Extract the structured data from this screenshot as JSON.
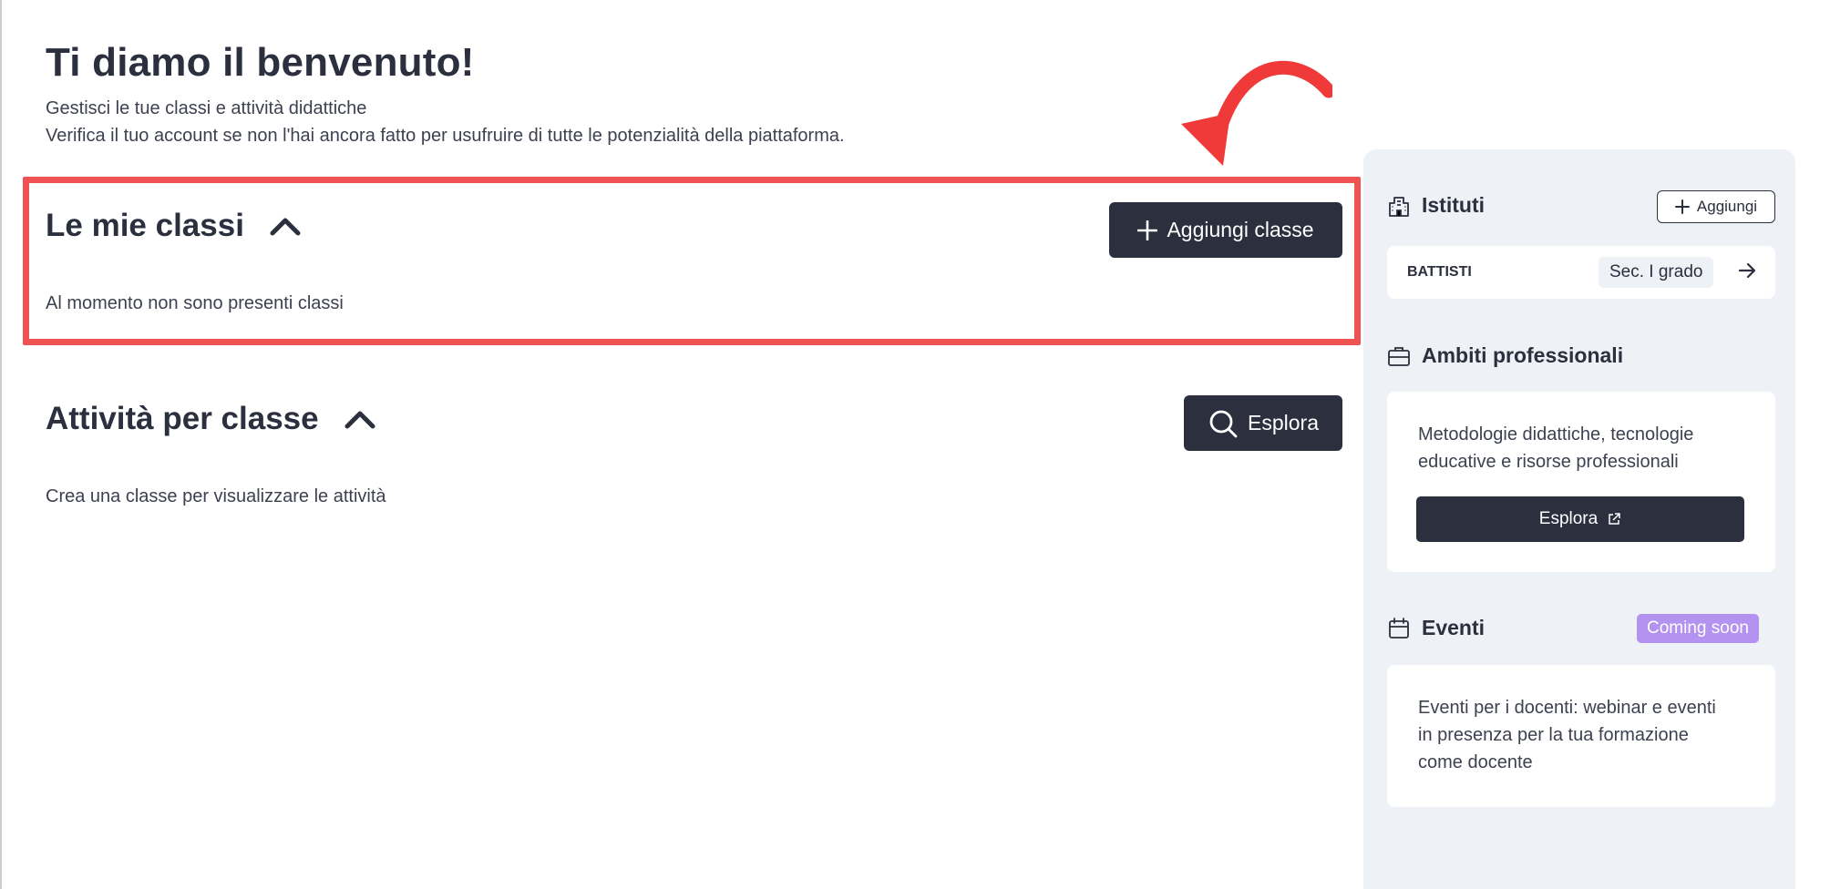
{
  "welcome": {
    "title": "Ti diamo il benvenuto!",
    "subtitle_line1": "Gestisci le tue classi e attività didattiche",
    "subtitle_line2": "Verifica il tuo account se non l'hai ancora fatto per usufruire di tutte le potenzialità della piattaforma."
  },
  "classes": {
    "title": "Le mie classi",
    "add_button": "Aggiungi classe",
    "empty_text": "Al momento non sono presenti classi"
  },
  "activities": {
    "title": "Attività per classe",
    "explore_button": "Esplora",
    "empty_text": "Crea una classe per visualizzare le attività"
  },
  "sidebar": {
    "institutes": {
      "title": "Istituti",
      "add_button": "Aggiungi",
      "items": [
        {
          "name": "BATTISTI",
          "grade": "Sec. I grado"
        }
      ]
    },
    "professional": {
      "title": "Ambiti professionali",
      "description": "Metodologie didattiche, tecnologie educative e risorse professionali",
      "button": "Esplora"
    },
    "events": {
      "title": "Eventi",
      "badge": "Coming soon",
      "description": "Eventi per i docenti: webinar e eventi in presenza per la tua formazione come docente"
    }
  },
  "colors": {
    "text_dark": "#2b2f3e",
    "highlight": "#f05252",
    "panel_bg": "#eef2f6",
    "badge": "#b392f0"
  },
  "icons": [
    "chevron-up-icon",
    "plus-icon",
    "search-icon",
    "building-icon",
    "briefcase-icon",
    "calendar-icon",
    "arrow-right-icon",
    "external-link-icon",
    "annotation-arrow-icon"
  ]
}
